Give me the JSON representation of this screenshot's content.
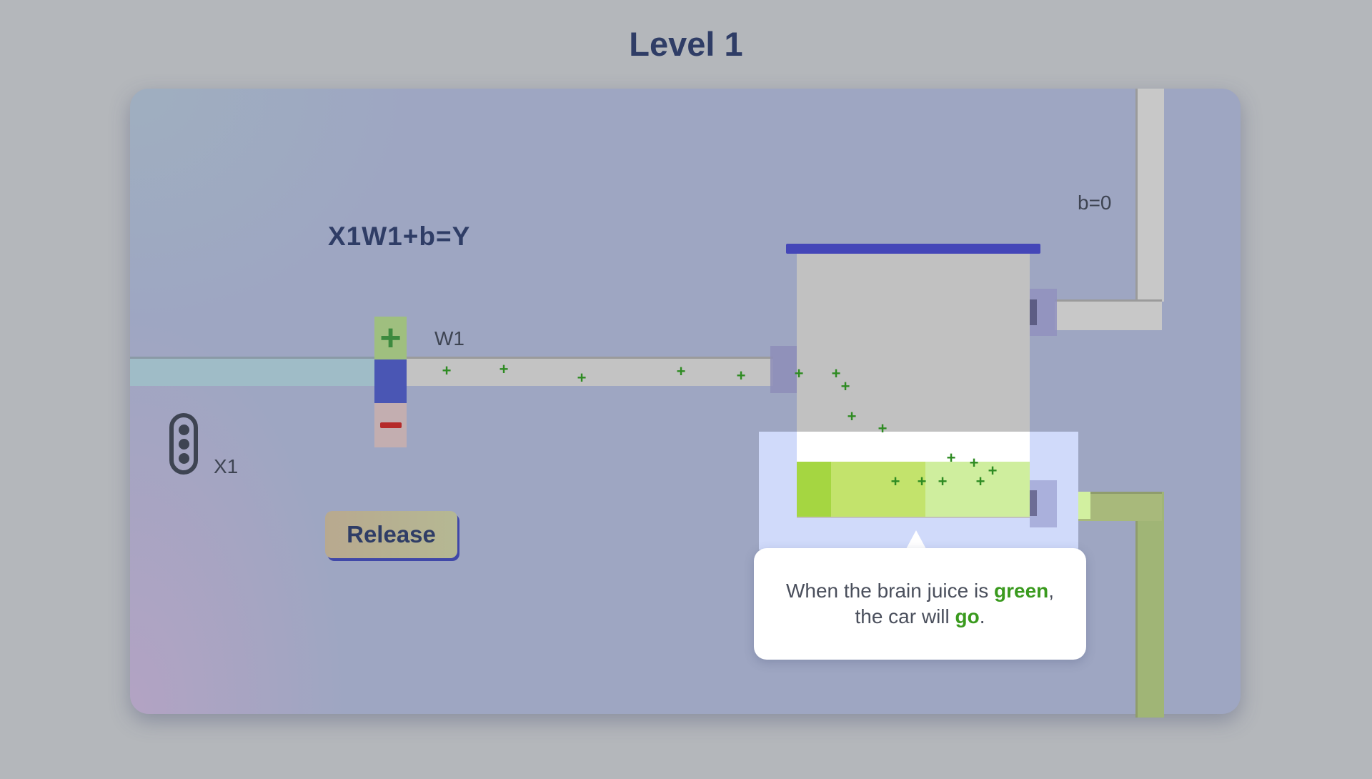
{
  "level_title": "Level 1",
  "formula": "X1W1+b=Y",
  "weight_label": "W1",
  "input_label": "X1",
  "bias_label": "b=0",
  "weight_controls": {
    "increase_label": "+"
  },
  "release_button": {
    "label": "Release"
  },
  "tooltip": {
    "part1": "When the brain juice is ",
    "highlight1": "green",
    "part2": ",",
    "part3": "the car will ",
    "highlight2": "go",
    "part4": "."
  },
  "particle_symbol": "+",
  "colors": {
    "title": "#2f3d66",
    "particle": "#2e8b22",
    "juice_green": "#a5d641",
    "lid": "#4446b8",
    "weight_block": "#4a56b4",
    "minus": "#b52a2a"
  }
}
